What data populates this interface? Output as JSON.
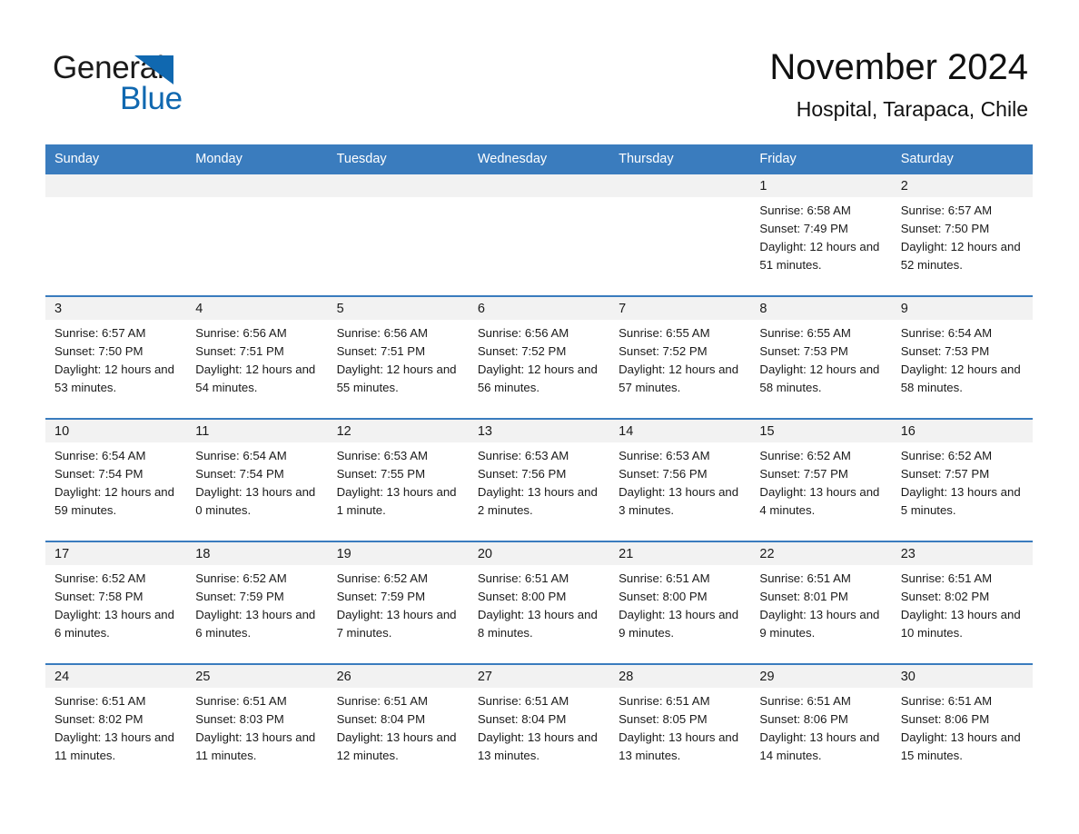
{
  "brand": {
    "name_part1": "General",
    "name_part2": "Blue",
    "triangle_color": "#1068b0"
  },
  "header": {
    "title": "November 2024",
    "subtitle": "Hospital, Tarapaca, Chile"
  },
  "theme": {
    "header_row_bg": "#3a7cbe",
    "header_row_text": "#ffffff",
    "day_number_bg": "#f2f2f2",
    "week_divider": "#3a7cbe",
    "page_bg": "#ffffff",
    "text": "#1a1a1a"
  },
  "weekdays": [
    "Sunday",
    "Monday",
    "Tuesday",
    "Wednesday",
    "Thursday",
    "Friday",
    "Saturday"
  ],
  "weeks": [
    [
      {
        "day": "",
        "empty": true,
        "sunrise": "",
        "sunset": "",
        "daylight": ""
      },
      {
        "day": "",
        "empty": true,
        "sunrise": "",
        "sunset": "",
        "daylight": ""
      },
      {
        "day": "",
        "empty": true,
        "sunrise": "",
        "sunset": "",
        "daylight": ""
      },
      {
        "day": "",
        "empty": true,
        "sunrise": "",
        "sunset": "",
        "daylight": ""
      },
      {
        "day": "",
        "empty": true,
        "sunrise": "",
        "sunset": "",
        "daylight": ""
      },
      {
        "day": "1",
        "empty": false,
        "sunrise": "Sunrise: 6:58 AM",
        "sunset": "Sunset: 7:49 PM",
        "daylight": "Daylight: 12 hours and 51 minutes."
      },
      {
        "day": "2",
        "empty": false,
        "sunrise": "Sunrise: 6:57 AM",
        "sunset": "Sunset: 7:50 PM",
        "daylight": "Daylight: 12 hours and 52 minutes."
      }
    ],
    [
      {
        "day": "3",
        "empty": false,
        "sunrise": "Sunrise: 6:57 AM",
        "sunset": "Sunset: 7:50 PM",
        "daylight": "Daylight: 12 hours and 53 minutes."
      },
      {
        "day": "4",
        "empty": false,
        "sunrise": "Sunrise: 6:56 AM",
        "sunset": "Sunset: 7:51 PM",
        "daylight": "Daylight: 12 hours and 54 minutes."
      },
      {
        "day": "5",
        "empty": false,
        "sunrise": "Sunrise: 6:56 AM",
        "sunset": "Sunset: 7:51 PM",
        "daylight": "Daylight: 12 hours and 55 minutes."
      },
      {
        "day": "6",
        "empty": false,
        "sunrise": "Sunrise: 6:56 AM",
        "sunset": "Sunset: 7:52 PM",
        "daylight": "Daylight: 12 hours and 56 minutes."
      },
      {
        "day": "7",
        "empty": false,
        "sunrise": "Sunrise: 6:55 AM",
        "sunset": "Sunset: 7:52 PM",
        "daylight": "Daylight: 12 hours and 57 minutes."
      },
      {
        "day": "8",
        "empty": false,
        "sunrise": "Sunrise: 6:55 AM",
        "sunset": "Sunset: 7:53 PM",
        "daylight": "Daylight: 12 hours and 58 minutes."
      },
      {
        "day": "9",
        "empty": false,
        "sunrise": "Sunrise: 6:54 AM",
        "sunset": "Sunset: 7:53 PM",
        "daylight": "Daylight: 12 hours and 58 minutes."
      }
    ],
    [
      {
        "day": "10",
        "empty": false,
        "sunrise": "Sunrise: 6:54 AM",
        "sunset": "Sunset: 7:54 PM",
        "daylight": "Daylight: 12 hours and 59 minutes."
      },
      {
        "day": "11",
        "empty": false,
        "sunrise": "Sunrise: 6:54 AM",
        "sunset": "Sunset: 7:54 PM",
        "daylight": "Daylight: 13 hours and 0 minutes."
      },
      {
        "day": "12",
        "empty": false,
        "sunrise": "Sunrise: 6:53 AM",
        "sunset": "Sunset: 7:55 PM",
        "daylight": "Daylight: 13 hours and 1 minute."
      },
      {
        "day": "13",
        "empty": false,
        "sunrise": "Sunrise: 6:53 AM",
        "sunset": "Sunset: 7:56 PM",
        "daylight": "Daylight: 13 hours and 2 minutes."
      },
      {
        "day": "14",
        "empty": false,
        "sunrise": "Sunrise: 6:53 AM",
        "sunset": "Sunset: 7:56 PM",
        "daylight": "Daylight: 13 hours and 3 minutes."
      },
      {
        "day": "15",
        "empty": false,
        "sunrise": "Sunrise: 6:52 AM",
        "sunset": "Sunset: 7:57 PM",
        "daylight": "Daylight: 13 hours and 4 minutes."
      },
      {
        "day": "16",
        "empty": false,
        "sunrise": "Sunrise: 6:52 AM",
        "sunset": "Sunset: 7:57 PM",
        "daylight": "Daylight: 13 hours and 5 minutes."
      }
    ],
    [
      {
        "day": "17",
        "empty": false,
        "sunrise": "Sunrise: 6:52 AM",
        "sunset": "Sunset: 7:58 PM",
        "daylight": "Daylight: 13 hours and 6 minutes."
      },
      {
        "day": "18",
        "empty": false,
        "sunrise": "Sunrise: 6:52 AM",
        "sunset": "Sunset: 7:59 PM",
        "daylight": "Daylight: 13 hours and 6 minutes."
      },
      {
        "day": "19",
        "empty": false,
        "sunrise": "Sunrise: 6:52 AM",
        "sunset": "Sunset: 7:59 PM",
        "daylight": "Daylight: 13 hours and 7 minutes."
      },
      {
        "day": "20",
        "empty": false,
        "sunrise": "Sunrise: 6:51 AM",
        "sunset": "Sunset: 8:00 PM",
        "daylight": "Daylight: 13 hours and 8 minutes."
      },
      {
        "day": "21",
        "empty": false,
        "sunrise": "Sunrise: 6:51 AM",
        "sunset": "Sunset: 8:00 PM",
        "daylight": "Daylight: 13 hours and 9 minutes."
      },
      {
        "day": "22",
        "empty": false,
        "sunrise": "Sunrise: 6:51 AM",
        "sunset": "Sunset: 8:01 PM",
        "daylight": "Daylight: 13 hours and 9 minutes."
      },
      {
        "day": "23",
        "empty": false,
        "sunrise": "Sunrise: 6:51 AM",
        "sunset": "Sunset: 8:02 PM",
        "daylight": "Daylight: 13 hours and 10 minutes."
      }
    ],
    [
      {
        "day": "24",
        "empty": false,
        "sunrise": "Sunrise: 6:51 AM",
        "sunset": "Sunset: 8:02 PM",
        "daylight": "Daylight: 13 hours and 11 minutes."
      },
      {
        "day": "25",
        "empty": false,
        "sunrise": "Sunrise: 6:51 AM",
        "sunset": "Sunset: 8:03 PM",
        "daylight": "Daylight: 13 hours and 11 minutes."
      },
      {
        "day": "26",
        "empty": false,
        "sunrise": "Sunrise: 6:51 AM",
        "sunset": "Sunset: 8:04 PM",
        "daylight": "Daylight: 13 hours and 12 minutes."
      },
      {
        "day": "27",
        "empty": false,
        "sunrise": "Sunrise: 6:51 AM",
        "sunset": "Sunset: 8:04 PM",
        "daylight": "Daylight: 13 hours and 13 minutes."
      },
      {
        "day": "28",
        "empty": false,
        "sunrise": "Sunrise: 6:51 AM",
        "sunset": "Sunset: 8:05 PM",
        "daylight": "Daylight: 13 hours and 13 minutes."
      },
      {
        "day": "29",
        "empty": false,
        "sunrise": "Sunrise: 6:51 AM",
        "sunset": "Sunset: 8:06 PM",
        "daylight": "Daylight: 13 hours and 14 minutes."
      },
      {
        "day": "30",
        "empty": false,
        "sunrise": "Sunrise: 6:51 AM",
        "sunset": "Sunset: 8:06 PM",
        "daylight": "Daylight: 13 hours and 15 minutes."
      }
    ]
  ]
}
